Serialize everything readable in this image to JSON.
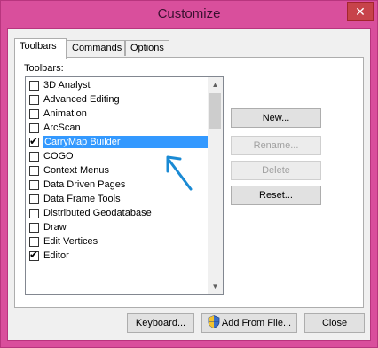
{
  "window": {
    "title": "Customize",
    "close_glyph": "✕"
  },
  "tabs": [
    {
      "label": "Toolbars",
      "active": true
    },
    {
      "label": "Commands",
      "active": false
    },
    {
      "label": "Options",
      "active": false
    }
  ],
  "toolbars_label": "Toolbars:",
  "toolbars_list": {
    "items": [
      {
        "label": "3D Analyst",
        "checked": false
      },
      {
        "label": "Advanced Editing",
        "checked": false
      },
      {
        "label": "Animation",
        "checked": false
      },
      {
        "label": "ArcScan",
        "checked": false
      },
      {
        "label": "CarryMap Builder",
        "checked": true,
        "selected": true
      },
      {
        "label": "COGO",
        "checked": false
      },
      {
        "label": "Context Menus",
        "checked": false
      },
      {
        "label": "Data Driven Pages",
        "checked": false
      },
      {
        "label": "Data Frame Tools",
        "checked": false
      },
      {
        "label": "Distributed Geodatabase",
        "checked": false
      },
      {
        "label": "Draw",
        "checked": false
      },
      {
        "label": "Edit Vertices",
        "checked": false
      },
      {
        "label": "Editor",
        "checked": true
      }
    ],
    "check_glyph": "✔",
    "scroll_up_glyph": "▲",
    "scroll_down_glyph": "▼"
  },
  "side_buttons": {
    "new": {
      "label": "New...",
      "enabled": true
    },
    "rename": {
      "label": "Rename...",
      "enabled": false
    },
    "delete": {
      "label": "Delete",
      "enabled": false
    },
    "reset": {
      "label": "Reset...",
      "enabled": true
    }
  },
  "bottom_buttons": {
    "keyboard": "Keyboard...",
    "add_from_file": "Add From File...",
    "close": "Close"
  },
  "colors": {
    "window_frame": "#d94f9c",
    "selection": "#3399ff",
    "annotation_arrow": "#1a8ad4"
  },
  "icons": {
    "shield": "uac-shield-icon",
    "annotation": "arrow-pointer-icon"
  }
}
